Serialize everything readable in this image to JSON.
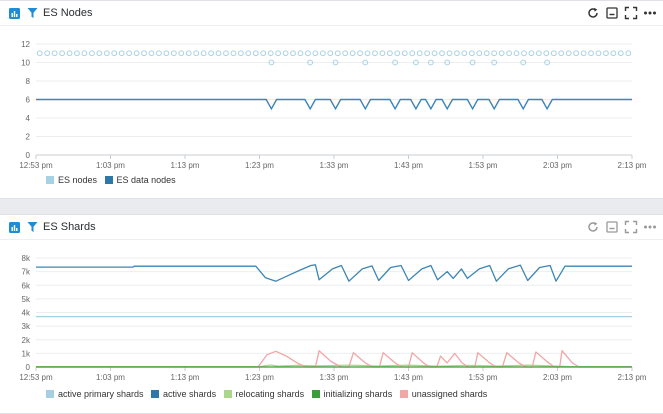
{
  "colors": {
    "nodes_light": "#a7d2e4",
    "nodes_dark": "#3a86b9",
    "active_primary": "#a6d0e2",
    "active": "#3c86b6",
    "relocating": "#abd78d",
    "initializing": "#3a9c3a",
    "unassigned": "#f2a6a6",
    "icon_blue": "#1f8dd6"
  },
  "panels": [
    {
      "title": "ES Nodes",
      "header_icons": [
        "bar-chart-icon",
        "filter-icon",
        "refresh-icon",
        "minimize-icon",
        "fullscreen-icon",
        "more-icon"
      ],
      "legend": [
        "ES nodes",
        "ES data nodes"
      ]
    },
    {
      "title": "ES Shards",
      "header_icons": [
        "bar-chart-icon",
        "filter-icon",
        "refresh-icon",
        "minimize-icon",
        "fullscreen-icon",
        "more-icon"
      ],
      "legend": [
        "active primary shards",
        "active shards",
        "relocating shards",
        "initializing shards",
        "unassigned shards"
      ]
    }
  ],
  "chart_data": [
    {
      "type": "line",
      "x_ticks": [
        "12:53 pm",
        "1:03 pm",
        "1:13 pm",
        "1:23 pm",
        "1:33 pm",
        "1:43 pm",
        "1:53 pm",
        "2:03 pm",
        "2:13 pm"
      ],
      "y_ticks": [
        "12",
        "10",
        "8",
        "6",
        "4",
        "2",
        "0"
      ],
      "ylim": [
        0,
        12
      ],
      "xlim": [
        0,
        80
      ],
      "dip_times": [
        1.6,
        6.8,
        10.2,
        14.2,
        18.2,
        21.0,
        23.0,
        25.2,
        28.6,
        31.5,
        35.4,
        38.6
      ],
      "series": [
        {
          "name": "ES nodes",
          "style": "markers",
          "values": [
            11,
            11,
            11,
            11,
            11,
            11,
            11,
            11,
            11,
            11,
            11,
            11,
            11,
            11,
            11,
            11,
            11,
            11,
            11,
            11,
            11,
            11,
            11,
            11,
            11,
            11,
            11,
            11,
            11,
            11,
            11,
            11,
            11,
            11,
            11,
            11,
            11,
            11,
            11,
            11,
            11,
            11,
            11,
            11,
            11,
            11,
            11,
            11,
            11,
            11,
            11,
            11,
            11,
            11,
            11,
            11,
            11,
            11,
            11,
            11,
            11,
            11,
            11,
            11,
            11,
            11,
            11,
            11,
            11,
            11,
            11,
            11,
            11,
            11,
            11,
            11,
            11,
            11,
            11,
            11,
            11
          ],
          "dip_value": 10
        },
        {
          "name": "ES data nodes",
          "style": "line",
          "base": 6,
          "dip_value": 5
        }
      ]
    },
    {
      "type": "line",
      "x_ticks": [
        "12:53 pm",
        "1:03 pm",
        "1:13 pm",
        "1:23 pm",
        "1:33 pm",
        "1:43 pm",
        "1:53 pm",
        "2:03 pm",
        "2:13 pm"
      ],
      "y_ticks": [
        "8k",
        "7k",
        "6k",
        "5k",
        "4k",
        "3k",
        "2k",
        "1k",
        "0"
      ],
      "ylim": [
        0,
        8000
      ],
      "xlim": [
        0,
        80
      ],
      "series": [
        {
          "name": "active primary shards",
          "points": [
            [
              0,
              3700
            ],
            [
              80,
              3700
            ]
          ]
        },
        {
          "name": "active shards",
          "points": [
            [
              0,
              7330
            ],
            [
              13,
              7330
            ],
            [
              13.2,
              7400
            ],
            [
              29.5,
              7400
            ],
            [
              30.8,
              6550
            ],
            [
              32.2,
              6300
            ],
            [
              33.8,
              6700
            ],
            [
              35.6,
              7150
            ],
            [
              36.9,
              7450
            ],
            [
              37.5,
              7500
            ],
            [
              38.0,
              6400
            ],
            [
              39.8,
              7200
            ],
            [
              41,
              7450
            ],
            [
              42.0,
              6300
            ],
            [
              43.8,
              7200
            ],
            [
              45.1,
              7420
            ],
            [
              46.0,
              6350
            ],
            [
              47.6,
              7300
            ],
            [
              49.0,
              7450
            ],
            [
              50.0,
              6350
            ],
            [
              51.8,
              7200
            ],
            [
              53.0,
              7450
            ],
            [
              53.9,
              6400
            ],
            [
              55.2,
              7000
            ],
            [
              56.0,
              6500
            ],
            [
              57.1,
              7200
            ],
            [
              57.9,
              6500
            ],
            [
              59.5,
              7200
            ],
            [
              60.9,
              7450
            ],
            [
              61.8,
              6300
            ],
            [
              63.4,
              7200
            ],
            [
              65.0,
              7480
            ],
            [
              66.0,
              6350
            ],
            [
              67.6,
              7300
            ],
            [
              69.0,
              7450
            ],
            [
              69.8,
              6300
            ],
            [
              71.0,
              7400
            ],
            [
              80,
              7400
            ]
          ]
        },
        {
          "name": "relocating shards",
          "points": [
            [
              0,
              30
            ],
            [
              30,
              30
            ],
            [
              31.5,
              150
            ],
            [
              32.5,
              60
            ],
            [
              35,
              120
            ],
            [
              38,
              80
            ],
            [
              42,
              140
            ],
            [
              46,
              70
            ],
            [
              50,
              130
            ],
            [
              54,
              60
            ],
            [
              58,
              120
            ],
            [
              62,
              70
            ],
            [
              66,
              130
            ],
            [
              70,
              60
            ],
            [
              72,
              30
            ],
            [
              80,
              30
            ]
          ]
        },
        {
          "name": "initializing shards",
          "points": [
            [
              0,
              0
            ],
            [
              80,
              0
            ]
          ]
        },
        {
          "name": "unassigned shards",
          "points": [
            [
              0,
              0
            ],
            [
              29.8,
              0
            ],
            [
              31.0,
              900
            ],
            [
              32.2,
              1150
            ],
            [
              33.6,
              800
            ],
            [
              35.2,
              250
            ],
            [
              36.3,
              0
            ],
            [
              37.5,
              0
            ],
            [
              38.0,
              1200
            ],
            [
              39.6,
              400
            ],
            [
              41.0,
              0
            ],
            [
              42.0,
              0
            ],
            [
              42.6,
              1050
            ],
            [
              44.2,
              300
            ],
            [
              45.2,
              0
            ],
            [
              46.1,
              0
            ],
            [
              46.6,
              1050
            ],
            [
              48.2,
              300
            ],
            [
              49.1,
              0
            ],
            [
              50.0,
              0
            ],
            [
              50.5,
              1050
            ],
            [
              52.0,
              300
            ],
            [
              52.9,
              0
            ],
            [
              53.8,
              0
            ],
            [
              54.3,
              800
            ],
            [
              55.2,
              300
            ],
            [
              56.2,
              1000
            ],
            [
              57.2,
              300
            ],
            [
              58.0,
              0
            ],
            [
              58.9,
              0
            ],
            [
              59.3,
              1050
            ],
            [
              60.9,
              300
            ],
            [
              61.8,
              0
            ],
            [
              62.6,
              0
            ],
            [
              63.2,
              1050
            ],
            [
              64.8,
              300
            ],
            [
              65.8,
              0
            ],
            [
              66.6,
              0
            ],
            [
              67.1,
              1100
            ],
            [
              68.7,
              350
            ],
            [
              69.6,
              0
            ],
            [
              70.3,
              0
            ],
            [
              70.6,
              1200
            ],
            [
              72.0,
              300
            ],
            [
              72.9,
              0
            ],
            [
              80,
              0
            ]
          ]
        }
      ]
    }
  ]
}
